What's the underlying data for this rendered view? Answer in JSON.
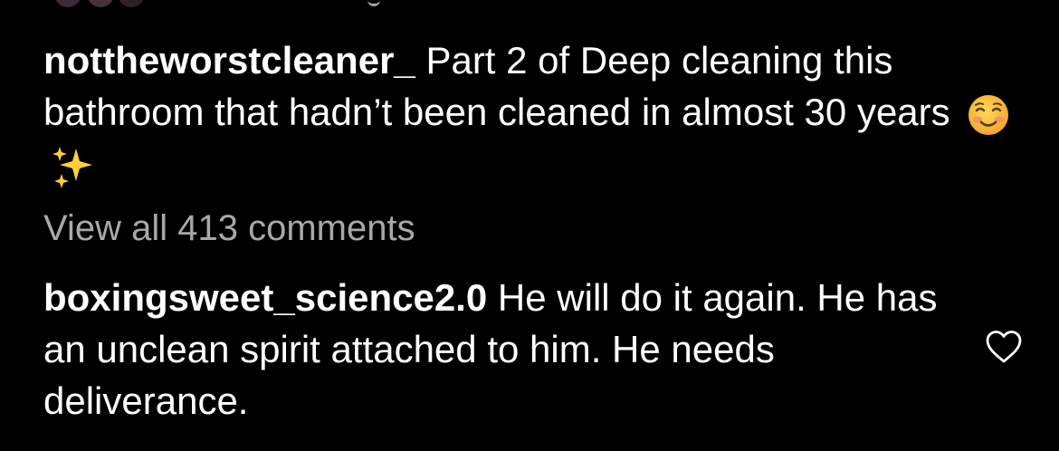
{
  "post": {
    "username": "nottheworstcleaner_",
    "caption": "Part 2 of Deep cleaning this bathroom that hadn’t been cleaned in almost 30 years",
    "emojis": [
      "smiling-face-emoji",
      "sparkles-emoji"
    ]
  },
  "comments_link": {
    "label": "View all 413 comments"
  },
  "comment": {
    "username": "boxingsweet_science2.0",
    "text": "He will do it again. He has an unclean spirit attached to him. He needs deliverance.",
    "like_icon": "heart-outline-icon"
  },
  "colors": {
    "background": "#000000",
    "text": "#ffffff",
    "muted_text": "#a8a8a8"
  }
}
